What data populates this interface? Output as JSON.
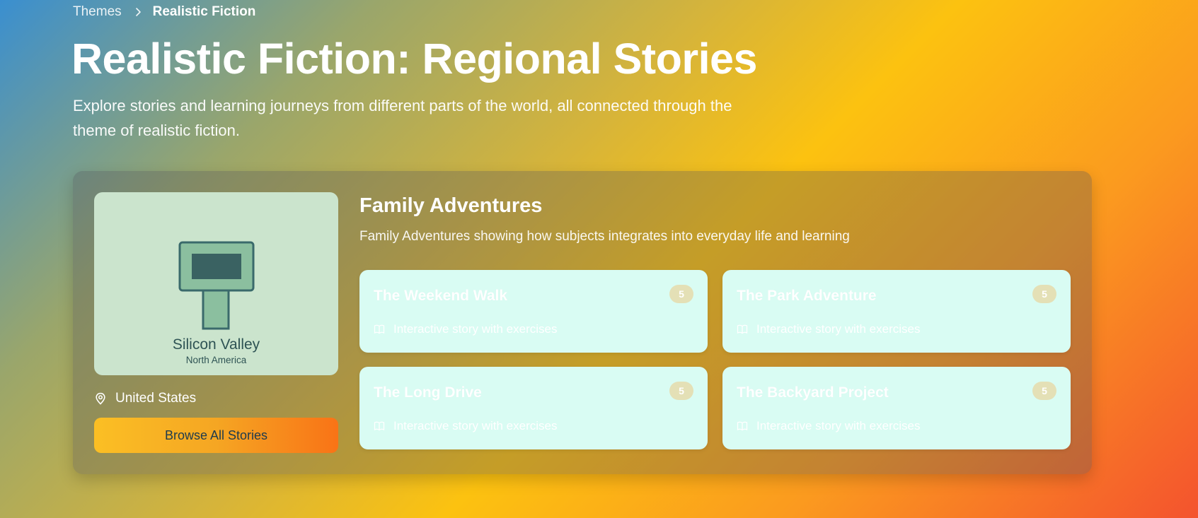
{
  "breadcrumb": {
    "parent": "Themes",
    "current": "Realistic Fiction"
  },
  "page": {
    "title": "Realistic Fiction: Regional Stories",
    "subtitle": "Explore stories and learning journeys from different parts of the world, all connected through the theme of realistic fiction."
  },
  "region": {
    "name": "Silicon Valley",
    "continent": "North America",
    "country": "United States",
    "browse_label": "Browse All Stories",
    "icon": "map-pin-icon"
  },
  "collection": {
    "title": "Family Adventures",
    "description": "Family Adventures showing how subjects integrates into everyday life and learning"
  },
  "stories": [
    {
      "title": "The Weekend Walk",
      "badge": "5",
      "meta": "Interactive story with exercises"
    },
    {
      "title": "The Park Adventure",
      "badge": "5",
      "meta": "Interactive story with exercises"
    },
    {
      "title": "The Long Drive",
      "badge": "5",
      "meta": "Interactive story with exercises"
    },
    {
      "title": "The Backyard Project",
      "badge": "5",
      "meta": "Interactive story with exercises"
    }
  ],
  "colors": {
    "story_card_bg": "#d9fcf3",
    "region_card_bg": "#cbe4cd",
    "button_gradient_start": "#fbbf24",
    "button_gradient_end": "#f97316"
  }
}
